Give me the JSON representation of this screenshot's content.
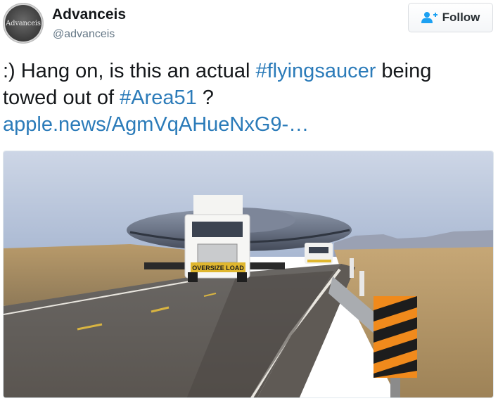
{
  "account": {
    "display_name": "Advanceis",
    "handle": "@advanceis",
    "avatar_text": "Advanceis"
  },
  "follow_button": {
    "label": "Follow",
    "icon": "add-user-icon"
  },
  "tweet": {
    "line1_pre": ":) Hang on, is this an actual ",
    "hashtag1": "#flyingsaucer",
    "line1_post": " being",
    "line2_pre": "towed out of ",
    "hashtag2": "#Area51",
    "line2_post": " ?",
    "link_text": "apple.news/AgmVqAHueNxG9-…"
  },
  "photo": {
    "truck_sign": "OVERSIZE LOAD"
  },
  "colors": {
    "link": "#2b7bb9",
    "text": "#14171a",
    "handle": "#657786",
    "follow_icon": "#1da1f2"
  }
}
